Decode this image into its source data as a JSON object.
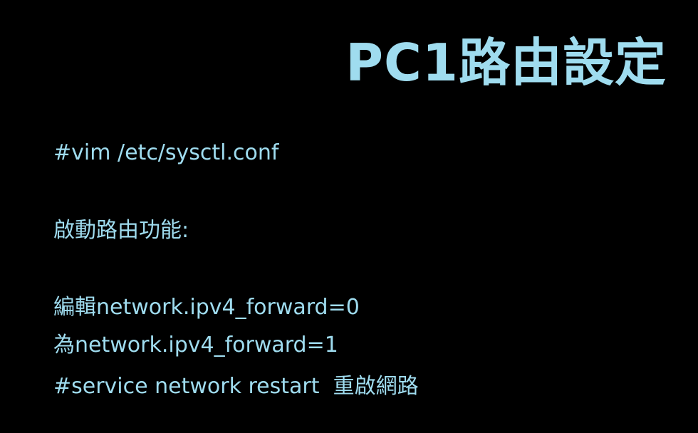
{
  "slide": {
    "title": "PC1路由設定",
    "lines": [
      "#vim /etc/sysctl.conf",
      "啟動路由功能:",
      "編輯network.ipv4_forward=0",
      "為network.ipv4_forward=1",
      "#service network restart  重啟網路"
    ]
  },
  "colors": {
    "background": "#000000",
    "text": "#9fdcef"
  }
}
